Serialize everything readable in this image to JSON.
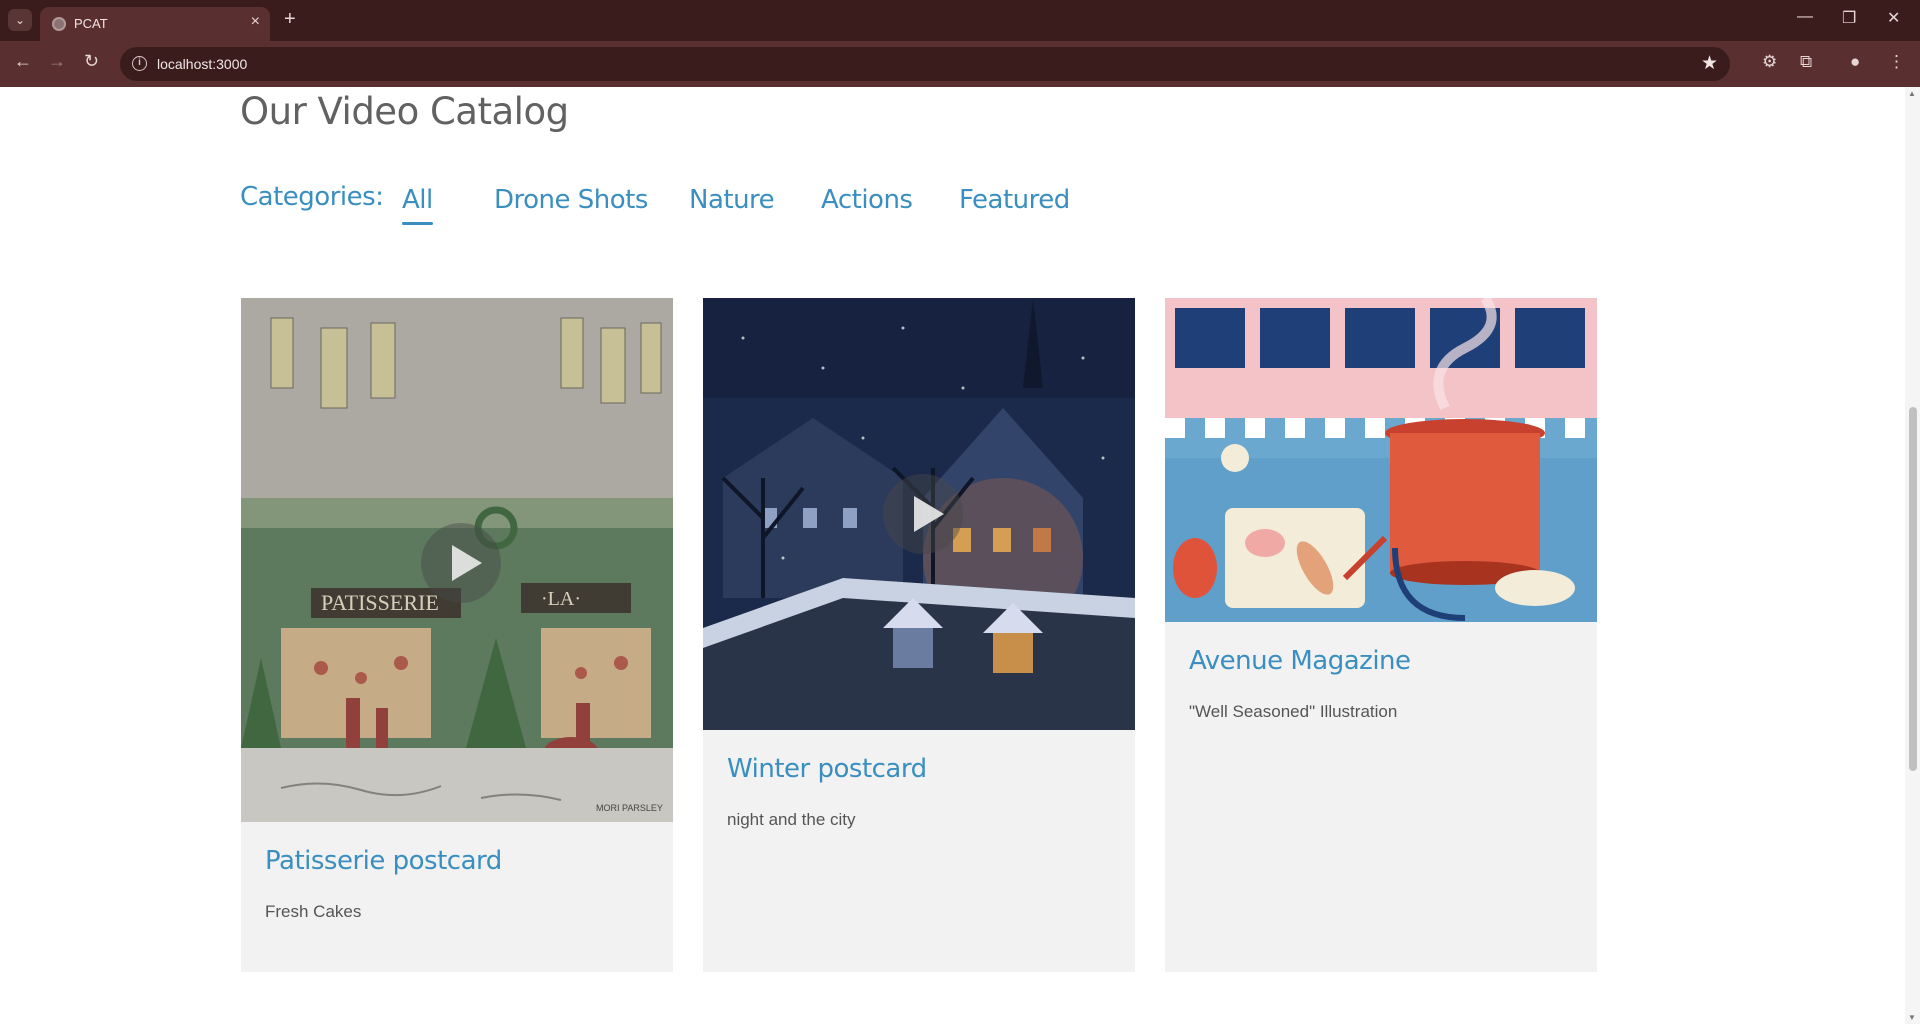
{
  "browser": {
    "tab_title": "PCAT",
    "url": "localhost:3000",
    "new_tab_symbol": "+",
    "tab_close_symbol": "×"
  },
  "page": {
    "title": "Our Video Catalog",
    "categories_label": "Categories:",
    "categories": [
      "All",
      "Drone Shots",
      "Nature",
      "Actions",
      "Featured"
    ],
    "active_category": "All"
  },
  "cards": [
    {
      "title": "Patisserie postcard",
      "description": "Fresh Cakes",
      "has_play_button": true,
      "image": "patisserie storefront illustration"
    },
    {
      "title": "Winter postcard",
      "description": "night and the city",
      "has_play_button": true,
      "image": "snowy night city rooftops"
    },
    {
      "title": "Avenue Magazine",
      "description": "\"Well Seasoned\" Illustration",
      "has_play_button": false,
      "image": "kitchen counter cooking illustration"
    }
  ],
  "signature": "MORI PARSLEY",
  "colors": {
    "accent": "#3a8fc0",
    "title_gray": "#616161",
    "card_bg": "#f2f2f2",
    "chrome_dark": "#3a1c1c",
    "chrome_mid": "#5a2f2f"
  }
}
